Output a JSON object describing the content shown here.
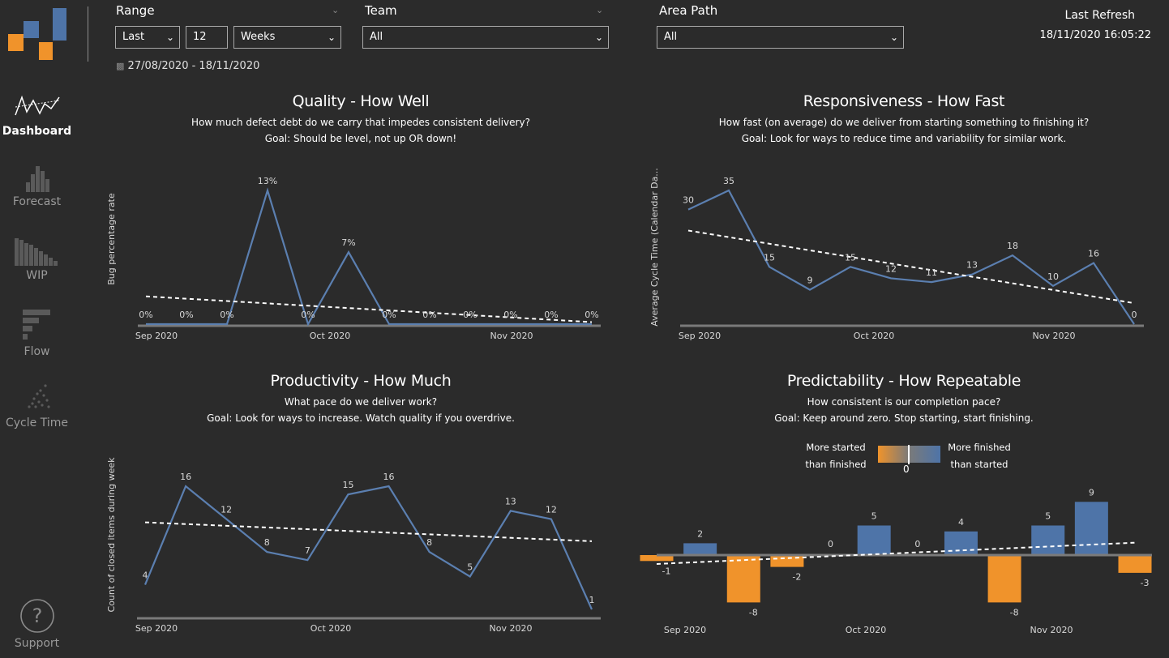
{
  "sidebar": {
    "items": [
      {
        "label": "Dashboard",
        "icon": "line-chart-icon",
        "active": true
      },
      {
        "label": "Forecast",
        "icon": "histogram-icon",
        "active": false
      },
      {
        "label": "WIP",
        "icon": "descending-bars-icon",
        "active": false
      },
      {
        "label": "Flow",
        "icon": "horizontal-bars-icon",
        "active": false
      },
      {
        "label": "Cycle Time",
        "icon": "scatter-icon",
        "active": false
      }
    ],
    "support_label": "Support"
  },
  "filters": {
    "range": {
      "label": "Range",
      "mode": "Last",
      "count": "12",
      "unit": "Weeks"
    },
    "team": {
      "label": "Team",
      "value": "All"
    },
    "area_path": {
      "label": "Area Path",
      "value": "All"
    },
    "date_range": "27/08/2020 - 18/11/2020"
  },
  "refresh": {
    "label": "Last Refresh",
    "value": "18/11/2020 16:05:22"
  },
  "colors": {
    "background": "#2b2b2b",
    "line": "#5b7fb0",
    "positive": "#4e74a8",
    "negative": "#f0932b",
    "trend": "#ffffff"
  },
  "charts": {
    "quality": {
      "title": "Quality - How Well",
      "subtitle1": "How much defect debt do we carry that impedes consistent delivery?",
      "subtitle2": "Goal: Should be level, not up OR down!"
    },
    "responsiveness": {
      "title": "Responsiveness - How Fast",
      "subtitle1": "How fast (on average) do we deliver from starting something to finishing it?",
      "subtitle2": "Goal: Look for ways to reduce time and variability for similar work."
    },
    "productivity": {
      "title": "Productivity - How Much",
      "subtitle1": "What pace do we deliver work?",
      "subtitle2": "Goal: Look for ways to increase. Watch quality if you overdrive."
    },
    "predictability": {
      "title": "Predictability - How Repeatable",
      "subtitle1": "How consistent is our completion pace?",
      "subtitle2": "Goal: Keep around zero. Stop starting, start finishing.",
      "legend_left_1": "More started",
      "legend_left_2": "than finished",
      "legend_right_1": "More finished",
      "legend_right_2": "than started",
      "legend_zero": "0"
    }
  },
  "chart_data": [
    {
      "id": "quality",
      "type": "line",
      "ylabel": "Bug percentage rate",
      "x_ticks": [
        "Sep 2020",
        "Oct 2020",
        "Nov 2020"
      ],
      "values": [
        0,
        0,
        0,
        13,
        0,
        7,
        0,
        0,
        0,
        0,
        0,
        0
      ],
      "labels": [
        "0%",
        "0%",
        "0%",
        "13%",
        "0%",
        "7%",
        "0%",
        "0%",
        "0%",
        "0%",
        "0%",
        "0%"
      ],
      "ylim": [
        0,
        13
      ],
      "trend": [
        2.7,
        0.2
      ]
    },
    {
      "id": "responsiveness",
      "type": "line",
      "ylabel": "Average Cycle Time (Calendar Da...",
      "x_ticks": [
        "Sep 2020",
        "Oct 2020",
        "Nov 2020"
      ],
      "values": [
        30,
        35,
        15,
        9,
        15,
        12,
        11,
        13,
        18,
        10,
        16,
        0
      ],
      "labels": [
        "30",
        "35",
        "15",
        "9",
        "15",
        "12",
        "11",
        "13",
        "18",
        "10",
        "16",
        "0"
      ],
      "ylim": [
        0,
        35
      ],
      "trend": [
        24.5,
        5.5
      ]
    },
    {
      "id": "productivity",
      "type": "line",
      "ylabel": "Count of closed items during week",
      "x_ticks": [
        "Sep 2020",
        "Oct 2020",
        "Nov 2020"
      ],
      "values": [
        4,
        16,
        12,
        8,
        7,
        15,
        16,
        8,
        5,
        13,
        12,
        1
      ],
      "labels": [
        "4",
        "16",
        "12",
        "8",
        "7",
        "15",
        "16",
        "8",
        "5",
        "13",
        "12",
        "1"
      ],
      "ylim": [
        1,
        16
      ],
      "trend": [
        11.6,
        9.3
      ]
    },
    {
      "id": "predictability",
      "type": "bar",
      "x_ticks": [
        "Sep 2020",
        "Oct 2020",
        "Nov 2020"
      ],
      "values": [
        -1,
        2,
        -8,
        -2,
        0,
        5,
        0,
        4,
        -8,
        5,
        9,
        -3
      ],
      "labels": [
        "-1",
        "2",
        "-8",
        "-2",
        "0",
        "5",
        "0",
        "4",
        "-8",
        "5",
        "9",
        "-3"
      ],
      "ylim": [
        -8,
        9
      ],
      "trend": [
        -1.5,
        2.1
      ]
    }
  ]
}
